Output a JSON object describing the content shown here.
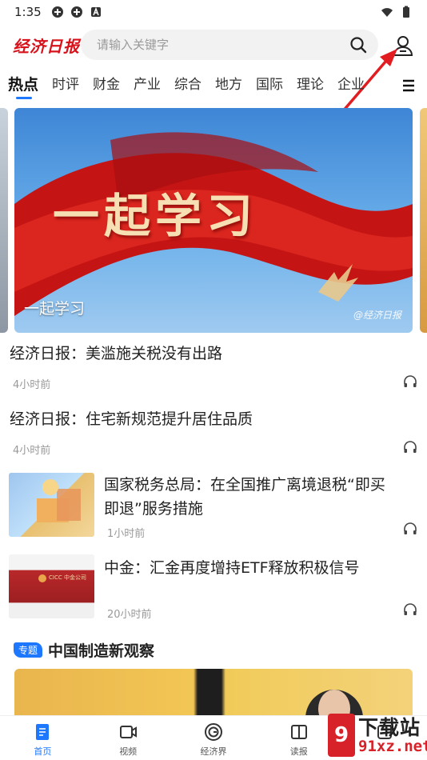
{
  "status_bar": {
    "time": "1:35"
  },
  "header": {
    "logo_text": "经济日报",
    "search_placeholder": "请输入关键字"
  },
  "tabs": [
    "热点",
    "时评",
    "财金",
    "产业",
    "综合",
    "地方",
    "国际",
    "理论",
    "企业"
  ],
  "active_tab": "热点",
  "banner": {
    "title_art": "一起学习",
    "caption": "一起学习",
    "watermark": "@经济日报"
  },
  "news": [
    {
      "title": "经济日报：美滥施关税没有出路",
      "time": "4小时前",
      "has_thumb": false
    },
    {
      "title": "经济日报：住宅新规范提升居住品质",
      "time": "4小时前",
      "has_thumb": false
    },
    {
      "title_line1": "国家税务总局：在全国推广离境退税“即买",
      "title_line2": "即退”服务措施",
      "time": "1小时前",
      "has_thumb": true
    },
    {
      "title": "中金：汇金再度增持ETF释放积极信号",
      "time": "20小时前",
      "has_thumb": true,
      "thumb_text": "CICC 中金公司"
    }
  ],
  "topic": {
    "tag": "专题",
    "title": "中国制造新观察"
  },
  "bottom_nav": [
    {
      "label": "首页",
      "icon": "home-icon"
    },
    {
      "label": "视频",
      "icon": "video-icon"
    },
    {
      "label": "经济界",
      "icon": "circle-icon"
    },
    {
      "label": "读报",
      "icon": "newspaper-icon"
    },
    {
      "label": "",
      "icon": "more-icon"
    }
  ],
  "watermark": {
    "brand_top": "下载站",
    "brand_bottom": "91xz.net",
    "logo_char": "9"
  },
  "colors": {
    "accent": "#1e78ff",
    "brand_red": "#d8121b"
  }
}
